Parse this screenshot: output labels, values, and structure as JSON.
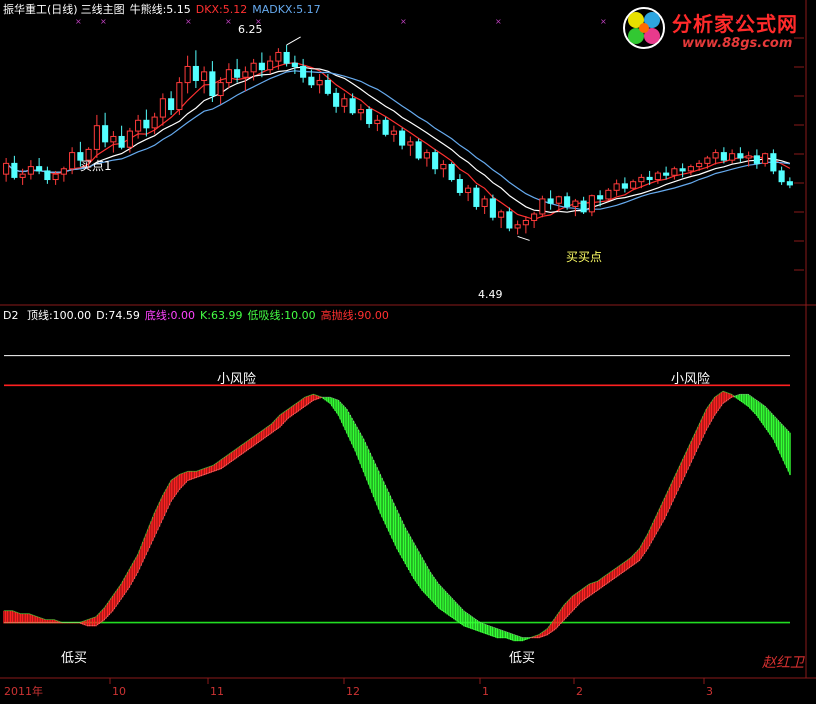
{
  "upper_legend": {
    "name": "振华重工(日线)",
    "study": "三线主图",
    "bull_label": "牛熊线:5.15",
    "dkx_label": "DKX:5.12",
    "madkx_label": "MADKX:5.17",
    "bull_color": "#ffffff",
    "dkx_color": "#ff3030",
    "madkx_color": "#66aaee"
  },
  "lower_legend": {
    "name": "D2",
    "items": [
      {
        "text": "顶线:100.00",
        "color": "#ffffff"
      },
      {
        "text": "D:74.59",
        "color": "#ffffff"
      },
      {
        "text": "底线:0.00",
        "color": "#ff44ff"
      },
      {
        "text": "K:63.99",
        "color": "#44ff44"
      },
      {
        "text": "低吸线:10.00",
        "color": "#44ff44"
      },
      {
        "text": "高抛线:90.00",
        "color": "#ff3030"
      }
    ]
  },
  "logo": {
    "title": "分析家公式网",
    "url": "www.88gs.com"
  },
  "x_axis": {
    "labels": [
      "2011年",
      "10",
      "11",
      "12",
      "1",
      "2",
      "3"
    ]
  },
  "watermark": "赵红卫",
  "chart_data": [
    {
      "type": "candlestick",
      "title": "振华重工(日线) 三线主图",
      "series_lines": [
        "牛熊线",
        "DKX",
        "MADKX"
      ],
      "ylim": [
        3.9,
        6.5
      ],
      "max_marker": "6.25",
      "min_marker": "4.49",
      "annotations": [
        "买点1",
        "买买点"
      ],
      "ohlc": [
        [
          5.05,
          5.2,
          4.98,
          5.15
        ],
        [
          5.15,
          5.22,
          5.0,
          5.02
        ],
        [
          5.02,
          5.1,
          4.95,
          5.05
        ],
        [
          5.05,
          5.18,
          5.0,
          5.12
        ],
        [
          5.12,
          5.2,
          5.05,
          5.08
        ],
        [
          5.08,
          5.12,
          4.96,
          5.0
        ],
        [
          5.0,
          5.08,
          4.95,
          5.05
        ],
        [
          5.05,
          5.12,
          4.98,
          5.1
        ],
        [
          5.1,
          5.3,
          5.05,
          5.25
        ],
        [
          5.25,
          5.35,
          5.12,
          5.18
        ],
        [
          5.18,
          5.3,
          5.1,
          5.28
        ],
        [
          5.28,
          5.6,
          5.2,
          5.5
        ],
        [
          5.5,
          5.62,
          5.3,
          5.35
        ],
        [
          5.35,
          5.45,
          5.25,
          5.4
        ],
        [
          5.4,
          5.5,
          5.28,
          5.3
        ],
        [
          5.3,
          5.48,
          5.25,
          5.45
        ],
        [
          5.45,
          5.6,
          5.38,
          5.55
        ],
        [
          5.55,
          5.65,
          5.4,
          5.48
        ],
        [
          5.48,
          5.62,
          5.42,
          5.58
        ],
        [
          5.58,
          5.8,
          5.5,
          5.75
        ],
        [
          5.75,
          5.82,
          5.6,
          5.65
        ],
        [
          5.65,
          5.95,
          5.6,
          5.9
        ],
        [
          5.9,
          6.15,
          5.8,
          6.05
        ],
        [
          6.05,
          6.2,
          5.85,
          5.92
        ],
        [
          5.92,
          6.05,
          5.8,
          6.0
        ],
        [
          6.0,
          6.1,
          5.72,
          5.78
        ],
        [
          5.78,
          5.95,
          5.7,
          5.9
        ],
        [
          5.9,
          6.08,
          5.85,
          6.02
        ],
        [
          6.02,
          6.12,
          5.9,
          5.95
        ],
        [
          5.95,
          6.05,
          5.82,
          6.0
        ],
        [
          6.0,
          6.12,
          5.92,
          6.08
        ],
        [
          6.08,
          6.18,
          5.95,
          6.02
        ],
        [
          6.02,
          6.15,
          5.98,
          6.1
        ],
        [
          6.1,
          6.22,
          6.02,
          6.18
        ],
        [
          6.18,
          6.25,
          6.05,
          6.08
        ],
        [
          6.08,
          6.15,
          5.98,
          6.05
        ],
        [
          6.05,
          6.12,
          5.9,
          5.95
        ],
        [
          5.95,
          6.02,
          5.85,
          5.88
        ],
        [
          5.88,
          5.98,
          5.8,
          5.92
        ],
        [
          5.92,
          5.98,
          5.78,
          5.8
        ],
        [
          5.8,
          5.85,
          5.62,
          5.68
        ],
        [
          5.68,
          5.8,
          5.62,
          5.75
        ],
        [
          5.75,
          5.8,
          5.6,
          5.62
        ],
        [
          5.62,
          5.7,
          5.55,
          5.65
        ],
        [
          5.65,
          5.68,
          5.48,
          5.52
        ],
        [
          5.52,
          5.6,
          5.45,
          5.55
        ],
        [
          5.55,
          5.58,
          5.4,
          5.42
        ],
        [
          5.42,
          5.5,
          5.35,
          5.45
        ],
        [
          5.45,
          5.48,
          5.28,
          5.32
        ],
        [
          5.32,
          5.4,
          5.22,
          5.35
        ],
        [
          5.35,
          5.38,
          5.18,
          5.2
        ],
        [
          5.2,
          5.28,
          5.12,
          5.25
        ],
        [
          5.25,
          5.28,
          5.05,
          5.1
        ],
        [
          5.1,
          5.18,
          5.02,
          5.14
        ],
        [
          5.14,
          5.16,
          4.98,
          5.0
        ],
        [
          5.0,
          5.05,
          4.85,
          4.88
        ],
        [
          4.88,
          4.95,
          4.8,
          4.92
        ],
        [
          4.92,
          4.95,
          4.72,
          4.75
        ],
        [
          4.75,
          4.85,
          4.68,
          4.82
        ],
        [
          4.82,
          4.86,
          4.62,
          4.65
        ],
        [
          4.65,
          4.72,
          4.55,
          4.7
        ],
        [
          4.7,
          4.74,
          4.52,
          4.55
        ],
        [
          4.55,
          4.62,
          4.49,
          4.58
        ],
        [
          4.58,
          4.66,
          4.5,
          4.62
        ],
        [
          4.62,
          4.7,
          4.55,
          4.68
        ],
        [
          4.68,
          4.85,
          4.65,
          4.82
        ],
        [
          4.82,
          4.9,
          4.72,
          4.78
        ],
        [
          4.78,
          4.85,
          4.7,
          4.84
        ],
        [
          4.84,
          4.88,
          4.72,
          4.75
        ],
        [
          4.75,
          4.82,
          4.66,
          4.8
        ],
        [
          4.8,
          4.84,
          4.68,
          4.7
        ],
        [
          4.7,
          4.86,
          4.66,
          4.85
        ],
        [
          4.85,
          4.9,
          4.75,
          4.82
        ],
        [
          4.82,
          4.92,
          4.8,
          4.9
        ],
        [
          4.9,
          5.0,
          4.85,
          4.96
        ],
        [
          4.96,
          5.02,
          4.88,
          4.92
        ],
        [
          4.92,
          5.0,
          4.9,
          4.98
        ],
        [
          4.98,
          5.05,
          4.92,
          5.02
        ],
        [
          5.02,
          5.08,
          4.95,
          5.0
        ],
        [
          5.0,
          5.08,
          4.96,
          5.06
        ],
        [
          5.06,
          5.12,
          5.0,
          5.04
        ],
        [
          5.04,
          5.12,
          5.0,
          5.1
        ],
        [
          5.1,
          5.15,
          5.02,
          5.08
        ],
        [
          5.08,
          5.14,
          5.04,
          5.12
        ],
        [
          5.12,
          5.18,
          5.08,
          5.15
        ],
        [
          5.15,
          5.22,
          5.1,
          5.2
        ],
        [
          5.2,
          5.28,
          5.14,
          5.25
        ],
        [
          5.25,
          5.3,
          5.15,
          5.18
        ],
        [
          5.18,
          5.28,
          5.15,
          5.24
        ],
        [
          5.24,
          5.3,
          5.16,
          5.2
        ],
        [
          5.2,
          5.26,
          5.12,
          5.22
        ],
        [
          5.22,
          5.28,
          5.1,
          5.15
        ],
        [
          5.15,
          5.25,
          5.12,
          5.24
        ],
        [
          5.24,
          5.28,
          5.05,
          5.08
        ],
        [
          5.08,
          5.12,
          4.95,
          4.98
        ],
        [
          4.98,
          5.02,
          4.92,
          4.95
        ]
      ]
    },
    {
      "type": "line",
      "title": "D2",
      "ylim": [
        -8,
        112
      ],
      "reference_lines": [
        {
          "name": "顶线",
          "value": 100
        },
        {
          "name": "高抛线",
          "value": 90
        },
        {
          "name": "低吸线",
          "value": 10
        },
        {
          "name": "底线",
          "value": 0
        }
      ],
      "annotations": [
        "小风险",
        "小风险",
        "低买",
        "低买"
      ],
      "K": [
        14,
        14,
        13,
        13,
        12,
        11,
        11,
        10,
        10,
        10,
        11,
        12,
        15,
        19,
        23,
        28,
        33,
        40,
        47,
        53,
        58,
        60,
        61,
        61,
        62,
        63,
        65,
        67,
        69,
        71,
        73,
        75,
        77,
        80,
        82,
        84,
        86,
        87,
        86,
        84,
        80,
        74,
        68,
        61,
        54,
        47,
        41,
        35,
        30,
        25,
        21,
        18,
        15,
        13,
        11,
        9,
        8,
        7,
        6,
        5,
        5,
        4,
        4,
        5,
        6,
        8,
        12,
        16,
        19,
        21,
        23,
        24,
        26,
        28,
        30,
        32,
        35,
        40,
        46,
        52,
        58,
        64,
        70,
        76,
        82,
        86,
        88,
        87,
        85,
        83,
        80,
        76,
        72,
        66,
        60
      ],
      "D": [
        10,
        10,
        10,
        10,
        10,
        10,
        10,
        10,
        10,
        10,
        9,
        9,
        11,
        14,
        18,
        22,
        27,
        33,
        39,
        45,
        51,
        55,
        58,
        59,
        60,
        61,
        62,
        64,
        66,
        68,
        70,
        72,
        74,
        76,
        79,
        81,
        83,
        85,
        86,
        86,
        85,
        82,
        77,
        72,
        66,
        60,
        54,
        48,
        42,
        37,
        32,
        27,
        23,
        20,
        17,
        14,
        12,
        10,
        9,
        8,
        7,
        6,
        5,
        5,
        5,
        6,
        8,
        11,
        14,
        17,
        19,
        21,
        23,
        25,
        27,
        29,
        31,
        35,
        40,
        45,
        51,
        57,
        63,
        69,
        75,
        80,
        84,
        86,
        87,
        87,
        85,
        83,
        80,
        77,
        74
      ]
    }
  ]
}
